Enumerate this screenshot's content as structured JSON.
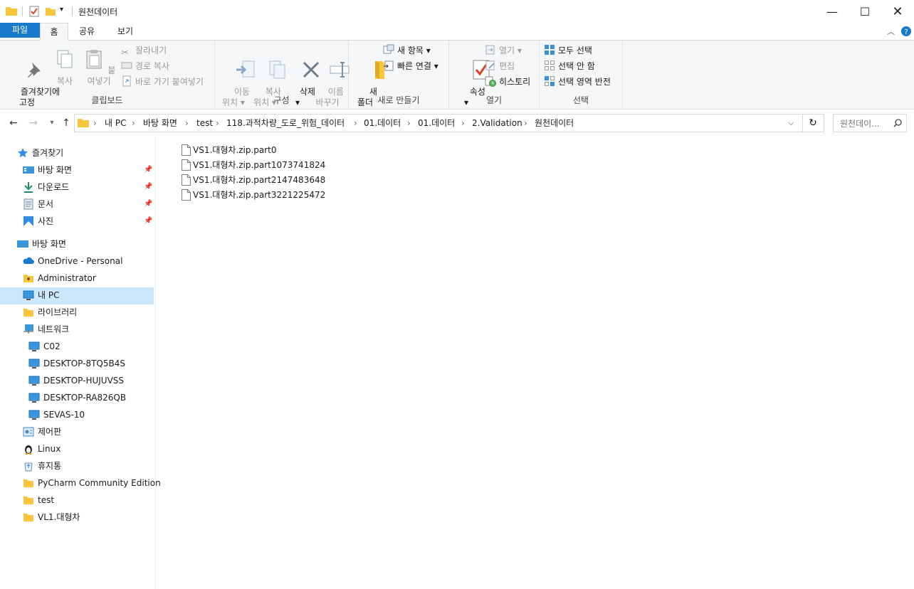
{
  "window": {
    "title": "원천데이터"
  },
  "ribbon_tabs": [
    "파일",
    "홈",
    "공유",
    "보기"
  ],
  "ribbon": {
    "clipboard": {
      "label": "클립보드",
      "pin": "즐겨찾기에\n고정",
      "copy": "복사",
      "paste": "붙여넣기",
      "cut": "잘라내기",
      "copy_path": "경로 복사",
      "paste_shortcut": "바로 가기 붙여넣기"
    },
    "organize": {
      "label": "구성",
      "move_to": "이동\n위치 ▾",
      "copy_to": "복사\n위치 ▾",
      "delete": "삭제\n▾",
      "rename": "이름\n바꾸기"
    },
    "new": {
      "label": "새로 만들기",
      "new_folder": "새\n폴더",
      "new_item": "새 항목 ▾",
      "easy_access": "빠른 연결 ▾"
    },
    "open": {
      "label": "열기",
      "properties": "속성\n▾",
      "open": "열기 ▾",
      "edit": "편집",
      "history": "히스토리"
    },
    "select": {
      "label": "선택",
      "select_all": "모두 선택",
      "select_none": "선택 안 함",
      "invert": "선택 영역 반전"
    }
  },
  "address": {
    "breadcrumbs": [
      "내 PC",
      "바탕 화면",
      "test",
      "118.과적차량_도로_위험_데이터",
      "01.데이터",
      "01.데이터",
      "2.Validation",
      "원천데이터"
    ],
    "search_placeholder": "원천데이..."
  },
  "nav": {
    "quick_access": "즐겨찾기",
    "quick_items": [
      "바탕 화면",
      "다운로드",
      "문서",
      "사진"
    ],
    "desktop": "바탕 화면",
    "desktop_items": [
      "OneDrive - Personal",
      "Administrator",
      "내 PC",
      "라이브러리",
      "네트워크"
    ],
    "network_items": [
      "C02",
      "DESKTOP-8TQ5B4S",
      "DESKTOP-HUJUVSS",
      "DESKTOP-RA826QB",
      "SEVAS-10"
    ],
    "other_items": [
      "제어판",
      "Linux",
      "휴지통",
      "PyCharm Community Edition",
      "test",
      "VL1.대형차"
    ],
    "selected": "내 PC"
  },
  "files": [
    "VS1.대형차.zip.part0",
    "VS1.대형차.zip.part1073741824",
    "VS1.대형차.zip.part2147483648",
    "VS1.대형차.zip.part3221225472"
  ],
  "colors": {
    "accent": "#1979ca",
    "selection": "#cce8ff",
    "folder": "#f8c63d"
  }
}
